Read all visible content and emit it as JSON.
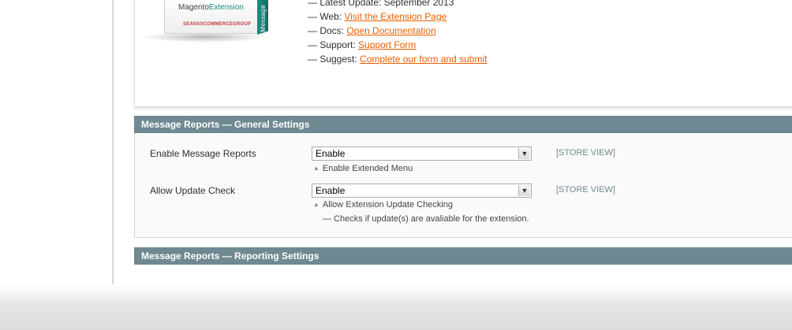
{
  "extension_info": {
    "product": {
      "title_part1": "Magento",
      "title_part2": "Extension",
      "side_text": "Message",
      "brand_text": "SEANSSCOMMERCEGROUP"
    },
    "latest_update": "— Latest Update: September 2013",
    "lines": [
      {
        "prefix": "— Web: ",
        "link": "Visit the Extension Page"
      },
      {
        "prefix": "— Docs: ",
        "link": "Open Documentation"
      },
      {
        "prefix": "— Support: ",
        "link": "Support Form"
      },
      {
        "prefix": "— Suggest: ",
        "link": "Complete our form and submit"
      }
    ]
  },
  "general_settings": {
    "title": "Message Reports — General Settings",
    "fields": [
      {
        "label": "Enable Message Reports",
        "value": "Enable",
        "scope": "[STORE VIEW]",
        "note": "Enable Extended Menu",
        "note_icon": "triangle-up-icon"
      },
      {
        "label": "Allow Update Check",
        "value": "Enable",
        "scope": "[STORE VIEW]",
        "note": "Allow Extension Update Checking",
        "note_icon": "triangle-up-icon",
        "sub_note": "— Checks if update(s) are avaliable for the extension."
      }
    ]
  },
  "reporting_settings": {
    "title": "Message Reports — Reporting Settings"
  },
  "colors": {
    "section_header": "#6f8992",
    "link": "#eb5e00",
    "scope": "#6f8992"
  }
}
